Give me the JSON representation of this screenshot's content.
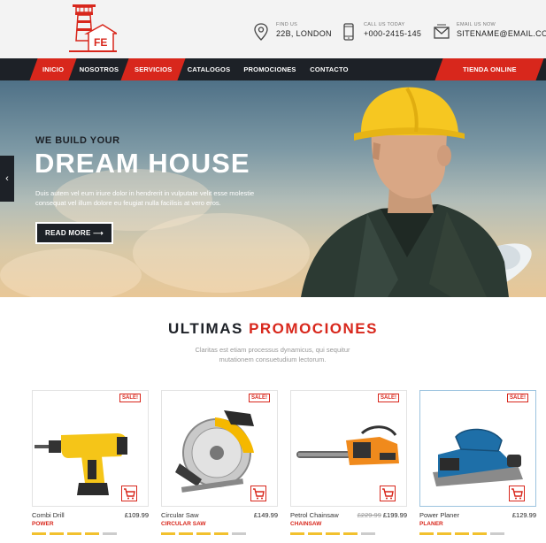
{
  "header": {
    "contacts": [
      {
        "label": "FIND US",
        "value": "22B, LONDON",
        "icon": "location-pin-icon"
      },
      {
        "label": "CALL US TODAY",
        "value": "+000-2415-145",
        "icon": "phone-icon"
      },
      {
        "label": "EMAIL US NOW",
        "value": "SITENAME@EMAIL.COM",
        "icon": "email-icon"
      }
    ]
  },
  "nav": {
    "items": [
      "INICIO",
      "NOSOTROS",
      "SERVICIOS",
      "CATALOGOS",
      "PROMOCIONES",
      "CONTACTO"
    ],
    "store": "TIENDA ONLINE"
  },
  "hero": {
    "pre_title": "WE BUILD YOUR",
    "title": "DREAM HOUSE",
    "text": "Duis autem vel eum iriure dolor in hendrerit in vulputate velit esse molestie consequat vel illum dolore eu feugiat nulla facilisis at vero eros.",
    "button": "READ MORE",
    "button_arrow": "⟶",
    "prev_arrow": "‹"
  },
  "section": {
    "title_a": "ULTIMAS",
    "title_b": "PROMOCIONES",
    "subtitle": "Claritas est etiam processus dynamicus, qui sequitur mutationem consuetudium lectorum."
  },
  "products": [
    {
      "name": "Combi Drill",
      "price": "£109.99",
      "old_price": "",
      "category": "POWER",
      "badge": "SALE!",
      "rating": 4
    },
    {
      "name": "Circular Saw",
      "price": "£149.99",
      "old_price": "",
      "category": "CIRCULAR SAW",
      "badge": "SALE!",
      "rating": 4
    },
    {
      "name": "Petrol Chainsaw",
      "price": "£199.99",
      "old_price": "£229.99",
      "category": "CHAINSAW",
      "badge": "SALE!",
      "rating": 4
    },
    {
      "name": "Power Planer",
      "price": "£129.99",
      "old_price": "",
      "category": "PLANER",
      "badge": "SALE!",
      "rating": 4
    }
  ],
  "colors": {
    "accent": "#d8271c",
    "dark": "#1d2127",
    "star": "#f2c12e"
  }
}
